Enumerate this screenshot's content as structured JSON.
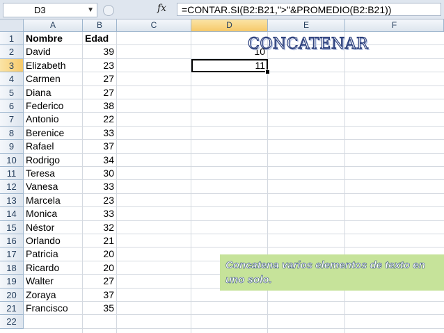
{
  "formula_bar": {
    "name_box": "D3",
    "name_box_dropdown": "▼",
    "fx_label": "fx",
    "formula": "=CONTAR.SI(B2:B21,\">\"&PROMEDIO(B2:B21))"
  },
  "columns": [
    "A",
    "B",
    "C",
    "D",
    "E",
    "F"
  ],
  "row_numbers": [
    "1",
    "2",
    "3",
    "4",
    "5",
    "6",
    "7",
    "8",
    "9",
    "10",
    "11",
    "12",
    "13",
    "14",
    "15",
    "16",
    "17",
    "18",
    "19",
    "20",
    "21",
    "22"
  ],
  "header_row": {
    "name": "Nombre",
    "age": "Edad"
  },
  "rows": [
    {
      "name": "David",
      "age": "39"
    },
    {
      "name": "Elizabeth",
      "age": "23"
    },
    {
      "name": "Carmen",
      "age": "27"
    },
    {
      "name": "Diana",
      "age": "27"
    },
    {
      "name": "Federico",
      "age": "38"
    },
    {
      "name": "Antonio",
      "age": "22"
    },
    {
      "name": "Berenice",
      "age": "33"
    },
    {
      "name": "Rafael",
      "age": "37"
    },
    {
      "name": "Rodrigo",
      "age": "34"
    },
    {
      "name": "Teresa",
      "age": "30"
    },
    {
      "name": "Vanesa",
      "age": "33"
    },
    {
      "name": "Marcela",
      "age": "23"
    },
    {
      "name": "Monica",
      "age": "33"
    },
    {
      "name": "Néstor",
      "age": "32"
    },
    {
      "name": "Orlando",
      "age": "21"
    },
    {
      "name": "Patricia",
      "age": "20"
    },
    {
      "name": "Ricardo",
      "age": "20"
    },
    {
      "name": "Walter",
      "age": "27"
    },
    {
      "name": "Zoraya",
      "age": "37"
    },
    {
      "name": "Francisco",
      "age": "35"
    }
  ],
  "column_d": {
    "d2": "10",
    "d3": "11"
  },
  "selected_cell": "D3",
  "title": "CONCATENAR",
  "note": "Concatena varios elementos de texto en uno solo.",
  "colors": {
    "note_background": "#c6e39a",
    "active_header": "#f6c96a",
    "title_outline": "#2b3f7c"
  }
}
